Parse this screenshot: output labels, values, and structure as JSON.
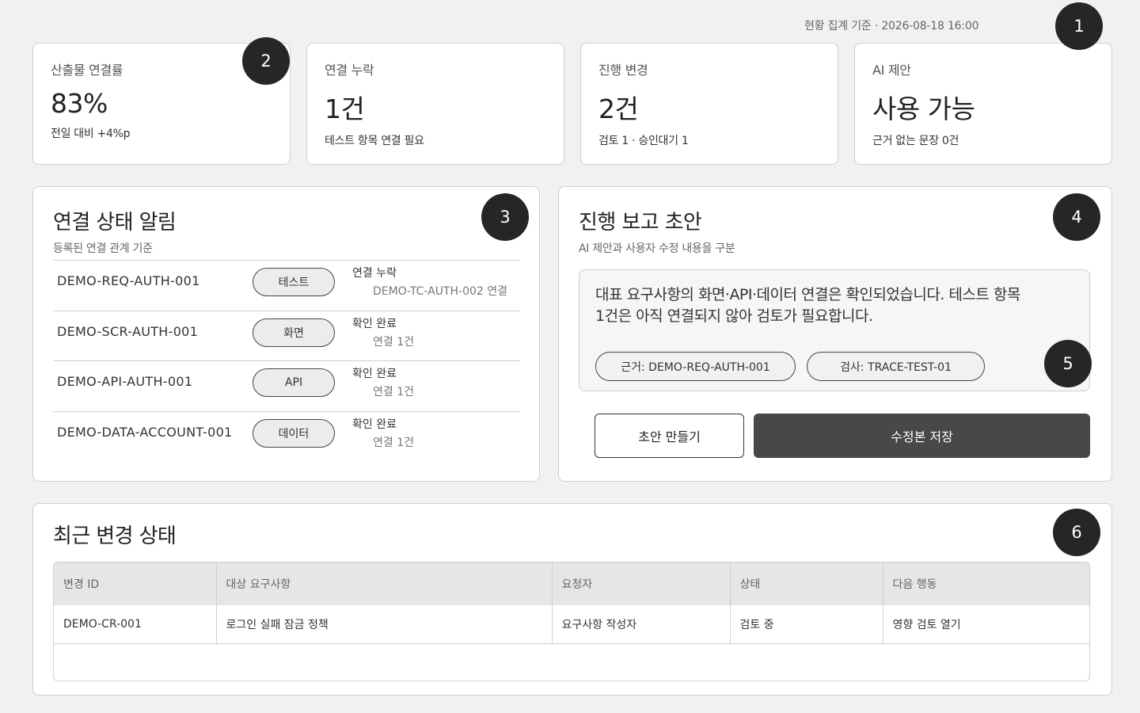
{
  "timestamp": "현황 집계 기준 · 2026-08-18 16:00",
  "markers": [
    "1",
    "2",
    "3",
    "4",
    "5",
    "6"
  ],
  "kpis": [
    {
      "label": "산출물 연결률",
      "value": "83%",
      "sub": "전일 대비 +4%p"
    },
    {
      "label": "연결 누락",
      "value": "1건",
      "sub": "테스트 항목 연결 필요"
    },
    {
      "label": "진행 변경",
      "value": "2건",
      "sub": "검토 1 · 승인대기 1"
    },
    {
      "label": "AI 제안",
      "value": "사용 가능",
      "sub": "근거 없는 문장 0건"
    }
  ],
  "links_panel": {
    "title": "연결 상태 알림",
    "subtitle": "등록된 연결 관계 기준",
    "rows": [
      {
        "id": "DEMO-REQ-AUTH-001",
        "chip": "테스트",
        "status": "연결 누락",
        "detail": "DEMO-TC-AUTH-002 연결"
      },
      {
        "id": "DEMO-SCR-AUTH-001",
        "chip": "화면",
        "status": "확인 완료",
        "detail": "연결 1건"
      },
      {
        "id": "DEMO-API-AUTH-001",
        "chip": "API",
        "status": "확인 완료",
        "detail": "연결 1건"
      },
      {
        "id": "DEMO-DATA-ACCOUNT-001",
        "chip": "데이터",
        "status": "확인 완료",
        "detail": "연결 1건"
      }
    ]
  },
  "report_panel": {
    "title": "진행 보고 초안",
    "subtitle": "AI 제안과 사용자 수정 내용을 구분",
    "draft_line1": "대표 요구사항의 화면·API·데이터 연결은 확인되었습니다. 테스트 항목",
    "draft_line2": "1건은 아직 연결되지 않아 검토가 필요합니다.",
    "evidence": [
      "근거: DEMO-REQ-AUTH-001",
      "검사: TRACE-TEST-01"
    ],
    "draft_button": "초안 만들기",
    "save_button": "수정본 저장"
  },
  "changes_panel": {
    "title": "최근 변경 상태",
    "columns": [
      "변경 ID",
      "대상 요구사항",
      "요청자",
      "상태",
      "다음 행동"
    ],
    "rows": [
      [
        "DEMO-CR-001",
        "로그인 실패 잠금 정책",
        "요구사항 작성자",
        "검토 중",
        "영향 검토 열기"
      ]
    ]
  }
}
